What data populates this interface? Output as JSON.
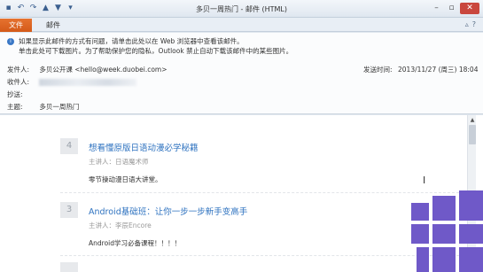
{
  "titlebar": {
    "title": "多贝一周热门 - 邮件 (HTML)",
    "qat_icons": [
      "save-icon",
      "undo-icon",
      "redo-icon",
      "up-arrow-icon",
      "down-arrow-icon",
      "dropdown-icon"
    ],
    "qat_glyphs": [
      "▪",
      "↶",
      "↷",
      "▲",
      "▼",
      "▾"
    ],
    "window_controls": [
      "–",
      "▫",
      "✕"
    ]
  },
  "ribbon": {
    "file_tab": "文件",
    "mail_tab": "邮件",
    "right_glyphs": [
      "▵",
      "?"
    ],
    "file_color": "#d8601f"
  },
  "header": {
    "info_icon": "i",
    "info_line1": "如果显示此邮件的方式有问题，请单击此处以在 Web 浏览器中查看该邮件。",
    "info_line2": "单击此处可下载图片。为了帮助保护您的隐私，Outlook 禁止自动下载该邮件中的某些图片。",
    "from_label": "发件人:",
    "from_value": "多贝公开课 <hello@week.duobei.com>",
    "sent_label": "发送时间:",
    "sent_value": "2013/11/27 (周三) 18:04",
    "to_label": "收件人:",
    "cc_label": "抄送:",
    "subject_label": "主题:",
    "subject_value": "多贝一周热门"
  },
  "items": [
    {
      "number": "4",
      "title": "想看懂原版日语动漫必学秘籍",
      "speaker": "主讲人：日语魔术师",
      "description": "零节操动漫日语大讲堂。"
    },
    {
      "number": "3",
      "title": "Android基础班：让你一步一步新手变高手",
      "speaker": "主讲人：李辰Encore",
      "description": "Android学习必备课程！！！！"
    },
    {
      "number": "",
      "title": "",
      "speaker": "",
      "description": ""
    }
  ],
  "scrollbar": {
    "up_glyph": "▲"
  },
  "cursor": "I",
  "colors": {
    "link": "#2f73c0",
    "logo": "#6f59c8",
    "close": "#c9473e"
  }
}
